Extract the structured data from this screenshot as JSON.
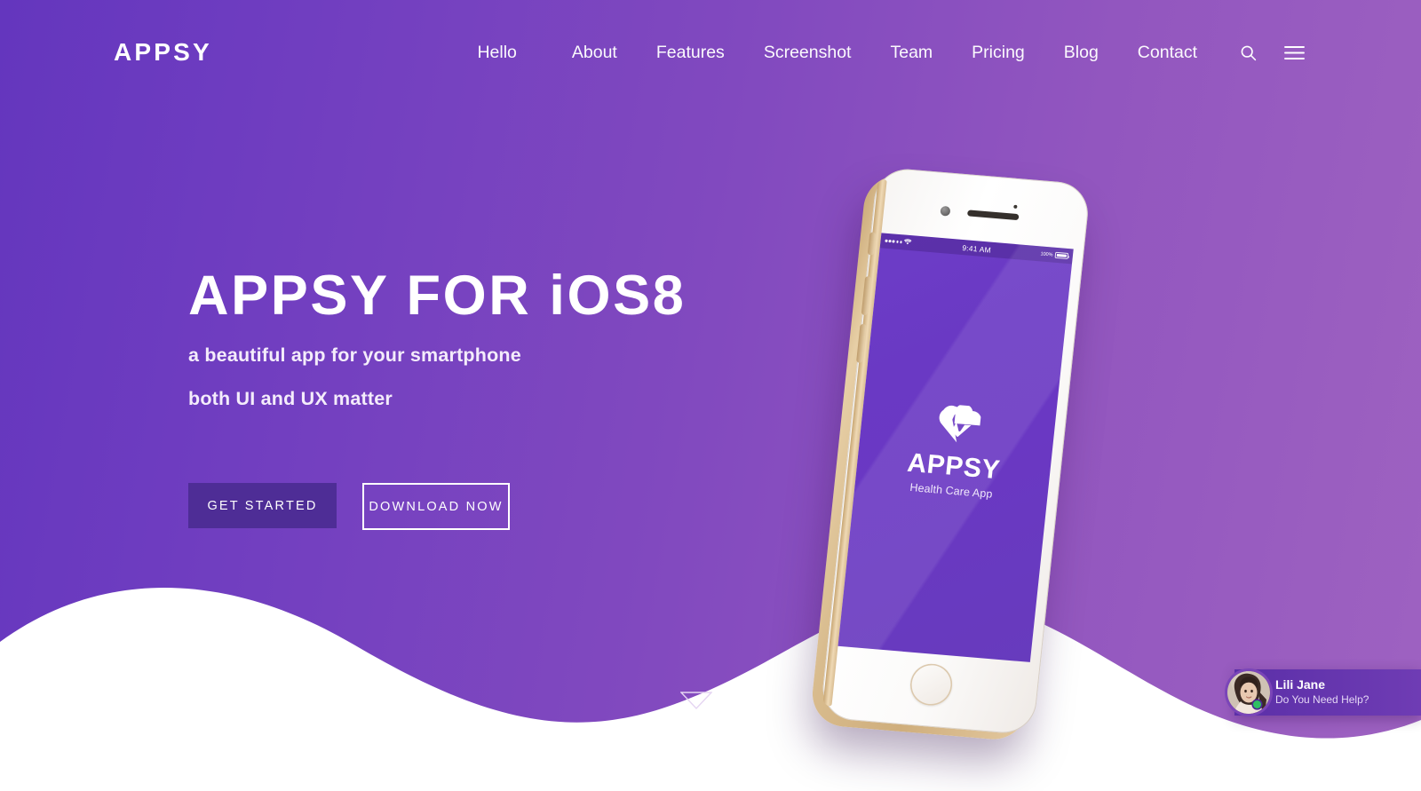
{
  "site": {
    "logo": "APPSY"
  },
  "nav": {
    "items": [
      {
        "label": "Hello"
      },
      {
        "label": "About"
      },
      {
        "label": "Features"
      },
      {
        "label": "Screenshot"
      },
      {
        "label": "Team"
      },
      {
        "label": "Pricing"
      },
      {
        "label": "Blog"
      },
      {
        "label": "Contact"
      }
    ],
    "icons": [
      {
        "name": "search-icon"
      },
      {
        "name": "hamburger-menu-icon"
      }
    ]
  },
  "hero": {
    "headline": "APPSY FOR iOS8",
    "subtitle_1": "a beautiful app for your smartphone",
    "subtitle_2": "both UI and UX matter",
    "primary_button": "GET STARTED",
    "secondary_button": "DOWNLOAD NOW",
    "scroll_hint_icon": "triangle-down-icon"
  },
  "phone": {
    "status_bar": {
      "signal": "•••••",
      "wifi_icon": "wifi-icon",
      "time": "9:41 AM",
      "battery_percent": "100%",
      "battery_icon": "battery-full-icon"
    },
    "app": {
      "logo_icon": "heart-pulse-icon",
      "title": "APPSY",
      "subtitle": "Health Care App"
    }
  },
  "chat_widget": {
    "agent_name": "Lili Jane",
    "message": "Do You Need Help?",
    "status": "online",
    "avatar_icon": "user-avatar-photo"
  },
  "colors": {
    "gradient_start": "#6436be",
    "gradient_end": "#9e62c1",
    "primary_button_bg": "#4e2d96",
    "text_on_dark": "#ffffff",
    "online_dot": "#2fbf63",
    "wave_fill": "#ffffff"
  }
}
